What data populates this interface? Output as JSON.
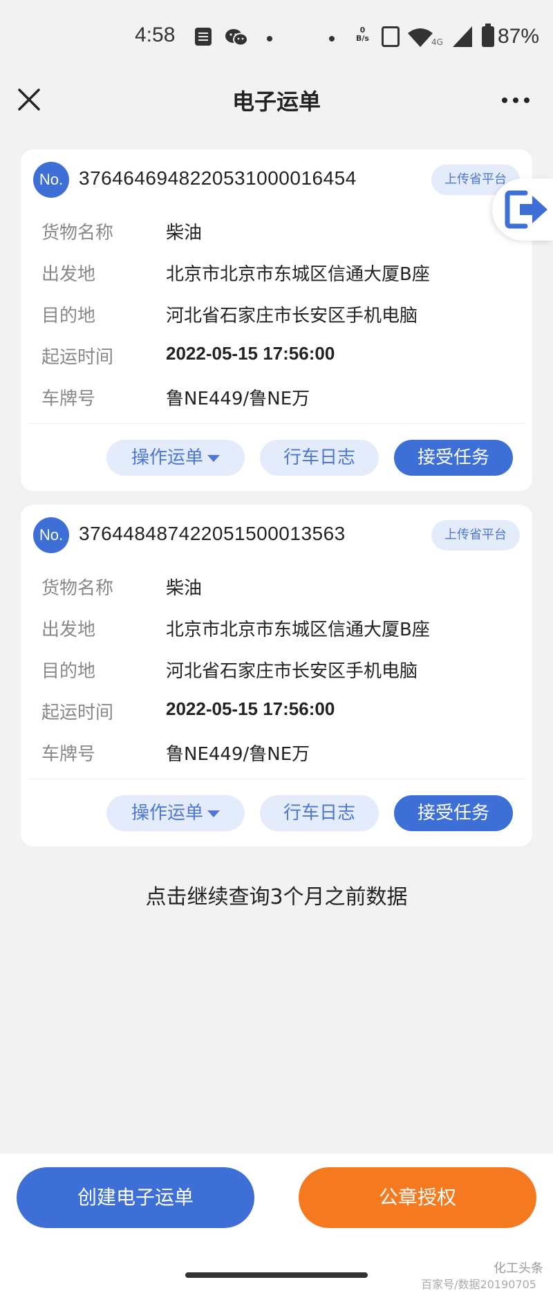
{
  "status_bar": {
    "time": "4:58",
    "net_speed_value": "0",
    "net_speed_unit": "B/s",
    "network_type": "4G",
    "battery": "87%"
  },
  "nav": {
    "title": "电子运单"
  },
  "floating_action": {
    "icon": "exit-icon"
  },
  "labels": {
    "no_badge": "No.",
    "upload_tag": "上传省平台",
    "goods_name": "货物名称",
    "origin": "出发地",
    "destination": "目的地",
    "start_time": "起运时间",
    "plate": "车牌号"
  },
  "buttons": {
    "operate": "操作运单",
    "driving_log": "行车日志",
    "accept": "接受任务"
  },
  "waybills": [
    {
      "number": "3764646948220531000016454",
      "goods": "柴油",
      "origin": "北京市北京市东城区信通大厦B座",
      "destination": "河北省石家庄市长安区手机电脑",
      "start_time": "2022-05-15 17:56:00",
      "plate": "鲁NE449/鲁NE万"
    },
    {
      "number": "376448487422051500013563",
      "goods": "柴油",
      "origin": "北京市北京市东城区信通大厦B座",
      "destination": "河北省石家庄市长安区手机电脑",
      "start_time": "2022-05-15 17:56:00",
      "plate": "鲁NE449/鲁NE万"
    }
  ],
  "more_link": "点击继续查询3个月之前数据",
  "bottom": {
    "create": "创建电子运单",
    "seal": "公章授权"
  },
  "watermark": {
    "brand": "化工头条",
    "source": "百家号/数据20190705"
  },
  "colors": {
    "primary": "#3e6fd7",
    "accent_orange": "#f57a1f",
    "tag_bg": "#e4ecfb"
  }
}
